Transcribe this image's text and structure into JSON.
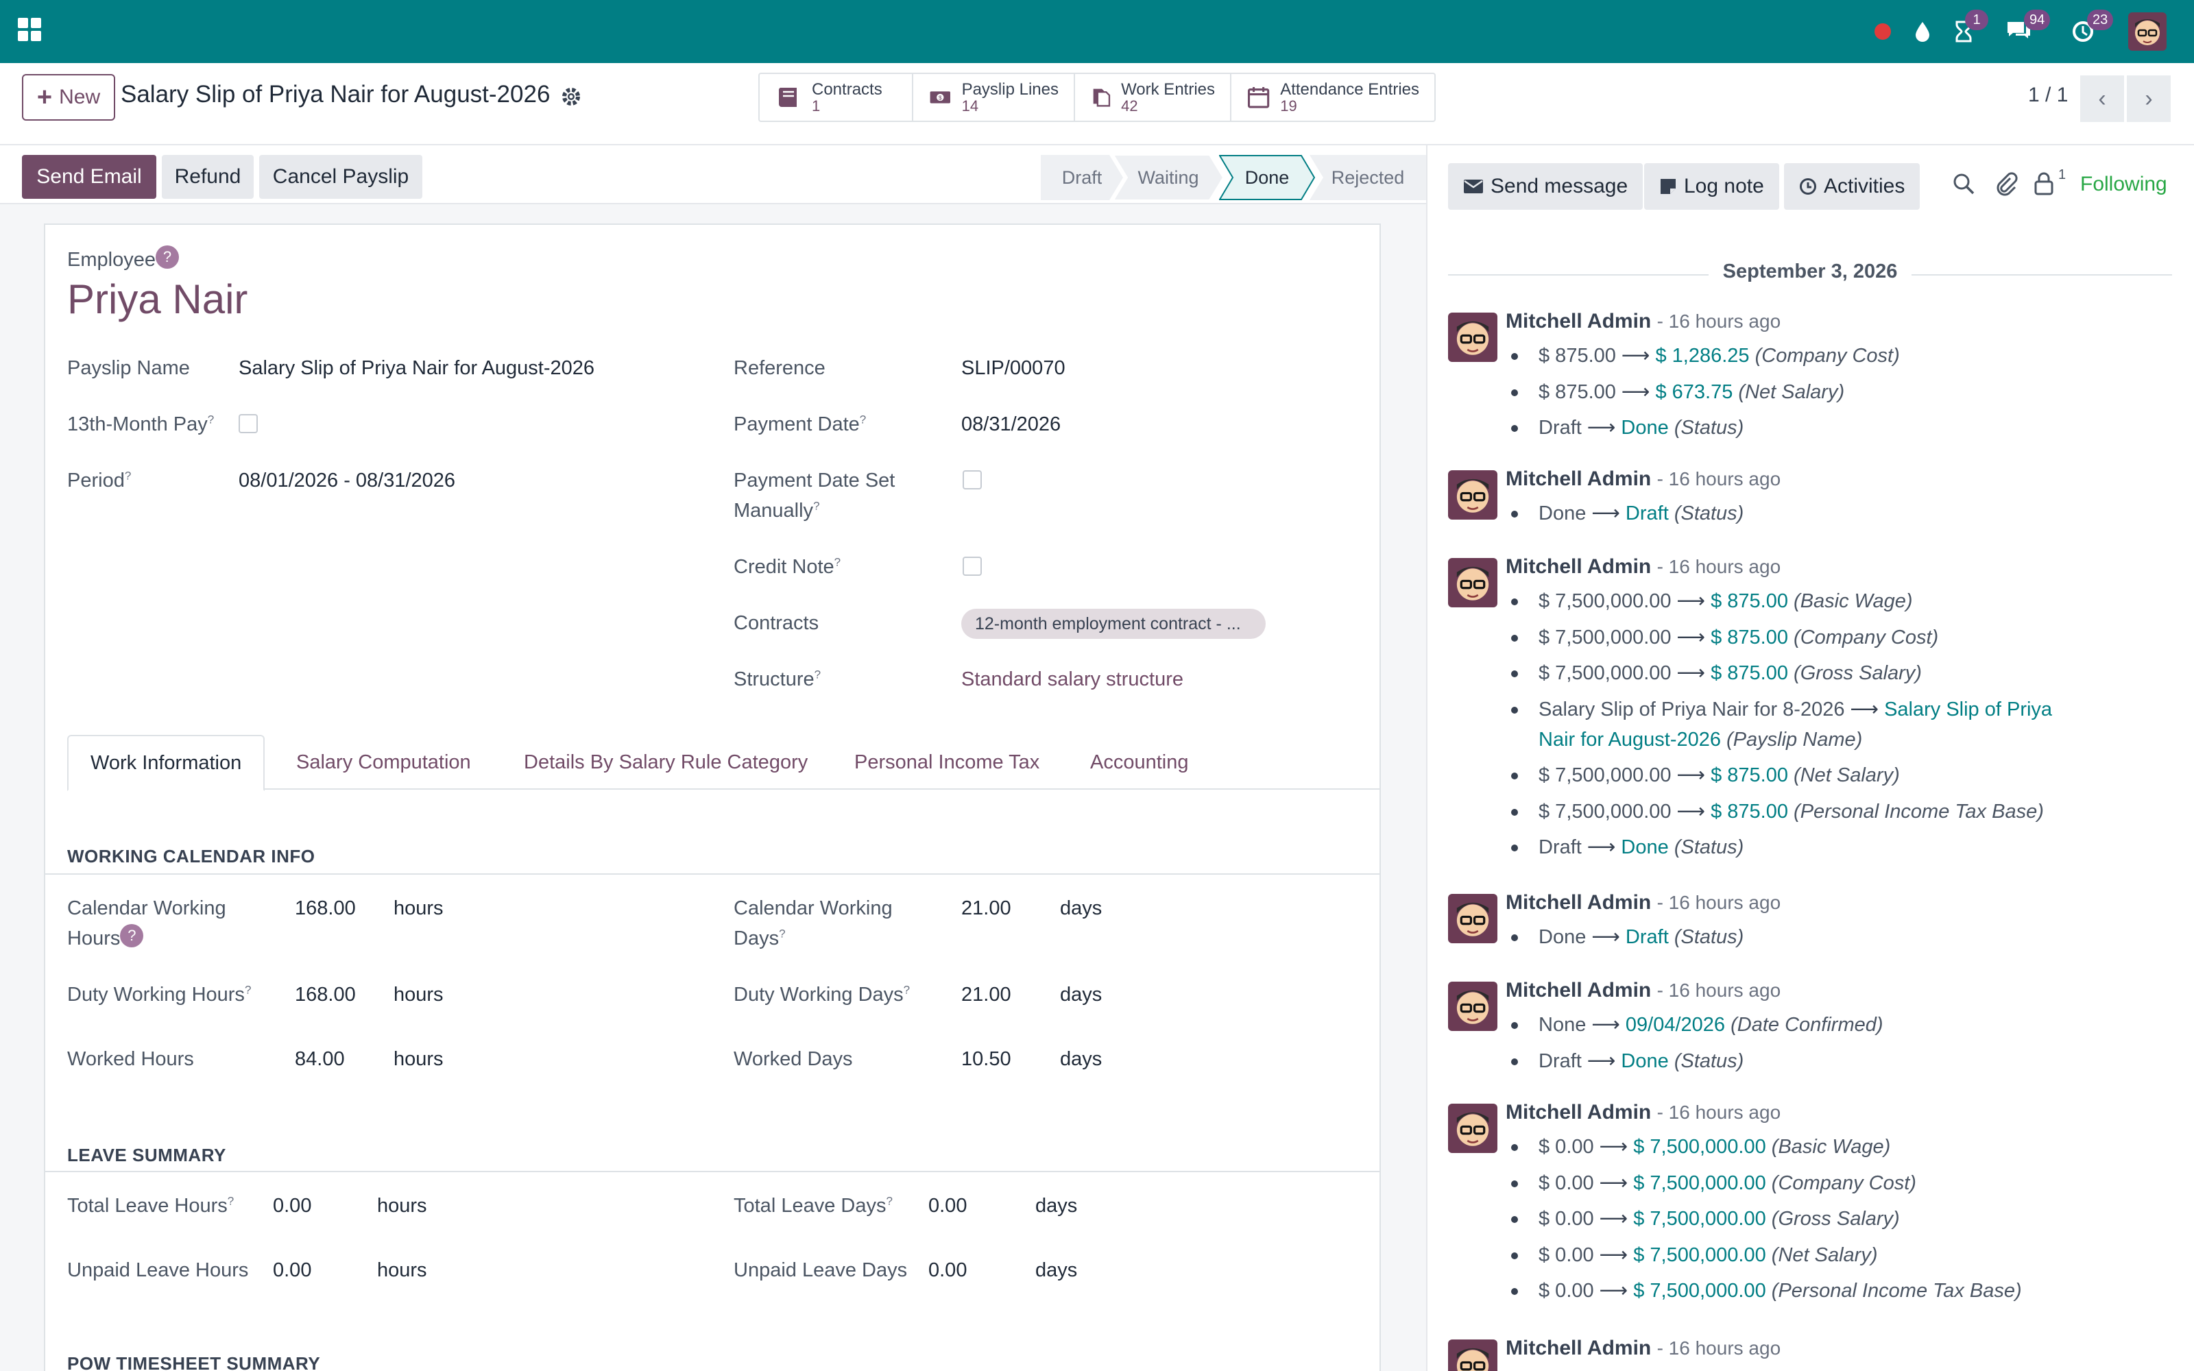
{
  "navbar": {
    "badges": {
      "activities": "1",
      "messages": "94",
      "updates": "23"
    }
  },
  "control_panel": {
    "new_button": "New",
    "breadcrumb_title": "Salary Slip of Priya Nair for August-2026",
    "smart_buttons": [
      {
        "label": "Contracts",
        "value": "1"
      },
      {
        "label": "Payslip Lines",
        "value": "14"
      },
      {
        "label": "Work Entries",
        "value": "42"
      },
      {
        "label": "Attendance Entries",
        "value": "19"
      }
    ],
    "pager": "1 / 1"
  },
  "statusbar": {
    "buttons": {
      "send_email": "Send Email",
      "refund": "Refund",
      "cancel": "Cancel Payslip"
    },
    "stages": [
      "Draft",
      "Waiting",
      "Done",
      "Rejected"
    ],
    "active_stage": "Done"
  },
  "form": {
    "employee_label": "Employee",
    "employee_name": "Priya Nair",
    "left_fields": {
      "payslip_name_label": "Payslip Name",
      "payslip_name": "Salary Slip of Priya Nair for August-2026",
      "thirteenth_label": "13th-Month Pay",
      "period_label": "Period",
      "period": "08/01/2026 - 08/31/2026"
    },
    "right_fields": {
      "reference_label": "Reference",
      "reference": "SLIP/00070",
      "payment_date_label": "Payment Date",
      "payment_date": "08/31/2026",
      "payment_date_manual_label_1": "Payment Date Set",
      "payment_date_manual_label_2": "Manually",
      "credit_note_label": "Credit Note",
      "contracts_label": "Contracts",
      "contract_tag": "12-month employment contract - ...",
      "structure_label": "Structure",
      "structure": "Standard salary structure"
    },
    "tabs": [
      "Work Information",
      "Salary Computation",
      "Details By Salary Rule Category",
      "Personal Income Tax",
      "Accounting"
    ],
    "working_calendar": {
      "title": "WORKING CALENDAR INFO",
      "cal_hours_label_1": "Calendar Working",
      "cal_hours_label_2": "Hours",
      "cal_hours": "168.00",
      "cal_days_label_1": "Calendar Working",
      "cal_days_label_2": "Days",
      "cal_days": "21.00",
      "duty_hours_label": "Duty Working Hours",
      "duty_hours": "168.00",
      "duty_days_label": "Duty Working Days",
      "duty_days": "21.00",
      "worked_hours_label": "Worked Hours",
      "worked_hours": "84.00",
      "worked_days_label": "Worked Days",
      "worked_days": "10.50",
      "unit_hours": "hours",
      "unit_days": "days"
    },
    "leave_summary": {
      "title": "LEAVE SUMMARY",
      "total_hours_label": "Total Leave Hours",
      "total_hours": "0.00",
      "total_days_label": "Total Leave Days",
      "total_days": "0.00",
      "unpaid_hours_label": "Unpaid Leave Hours",
      "unpaid_hours": "0.00",
      "unpaid_days_label": "Unpaid Leave Days",
      "unpaid_days": "0.00"
    },
    "timesheet_title": "POW TIMESHEET SUMMARY"
  },
  "chatter": {
    "send_message": "Send message",
    "log_note": "Log note",
    "activities": "Activities",
    "followers_count": "1",
    "following": "Following",
    "date": "September 3, 2026",
    "messages": [
      {
        "author": "Mitchell Admin",
        "time": "- 16 hours ago",
        "changes": [
          {
            "old": "$ 875.00",
            "new": "$ 1,286.25",
            "field": "(Company Cost)"
          },
          {
            "old": "$ 875.00",
            "new": "$ 673.75",
            "field": "(Net Salary)"
          },
          {
            "old": "Draft",
            "new": "Done",
            "field": "(Status)"
          }
        ]
      },
      {
        "author": "Mitchell Admin",
        "time": "- 16 hours ago",
        "changes": [
          {
            "old": "Done",
            "new": "Draft",
            "field": "(Status)"
          }
        ]
      },
      {
        "author": "Mitchell Admin",
        "time": "- 16 hours ago",
        "changes": [
          {
            "old": "$ 7,500,000.00",
            "new": "$ 875.00",
            "field": "(Basic Wage)"
          },
          {
            "old": "$ 7,500,000.00",
            "new": "$ 875.00",
            "field": "(Company Cost)"
          },
          {
            "old": "$ 7,500,000.00",
            "new": "$ 875.00",
            "field": "(Gross Salary)"
          },
          {
            "old": "Salary Slip of Priya Nair for 8-2026",
            "new": "Salary Slip of Priya",
            "new2": "Nair for August-2026",
            "field": "(Payslip Name)"
          },
          {
            "old": "$ 7,500,000.00",
            "new": "$ 875.00",
            "field": "(Net Salary)"
          },
          {
            "old": "$ 7,500,000.00",
            "new": "$ 875.00",
            "field": "(Personal Income Tax Base)"
          },
          {
            "old": "Draft",
            "new": "Done",
            "field": "(Status)"
          }
        ]
      },
      {
        "author": "Mitchell Admin",
        "time": "- 16 hours ago",
        "changes": [
          {
            "old": "Done",
            "new": "Draft",
            "field": "(Status)"
          }
        ]
      },
      {
        "author": "Mitchell Admin",
        "time": "- 16 hours ago",
        "changes": [
          {
            "old": "None",
            "new": "09/04/2026",
            "field": "(Date Confirmed)"
          },
          {
            "old": "Draft",
            "new": "Done",
            "field": "(Status)"
          }
        ]
      },
      {
        "author": "Mitchell Admin",
        "time": "- 16 hours ago",
        "changes": [
          {
            "old": "$ 0.00",
            "new": "$ 7,500,000.00",
            "field": "(Basic Wage)"
          },
          {
            "old": "$ 0.00",
            "new": "$ 7,500,000.00",
            "field": "(Company Cost)"
          },
          {
            "old": "$ 0.00",
            "new": "$ 7,500,000.00",
            "field": "(Gross Salary)"
          },
          {
            "old": "$ 0.00",
            "new": "$ 7,500,000.00",
            "field": "(Net Salary)"
          },
          {
            "old": "$ 0.00",
            "new": "$ 7,500,000.00",
            "field": "(Personal Income Tax Base)"
          }
        ]
      },
      {
        "author": "Mitchell Admin",
        "time": "- 16 hours ago",
        "changes": []
      }
    ]
  },
  "colors": {
    "navbar": "#017e84",
    "primary": "#714b67",
    "link_new_value": "#017e84",
    "following": "#28a745"
  }
}
